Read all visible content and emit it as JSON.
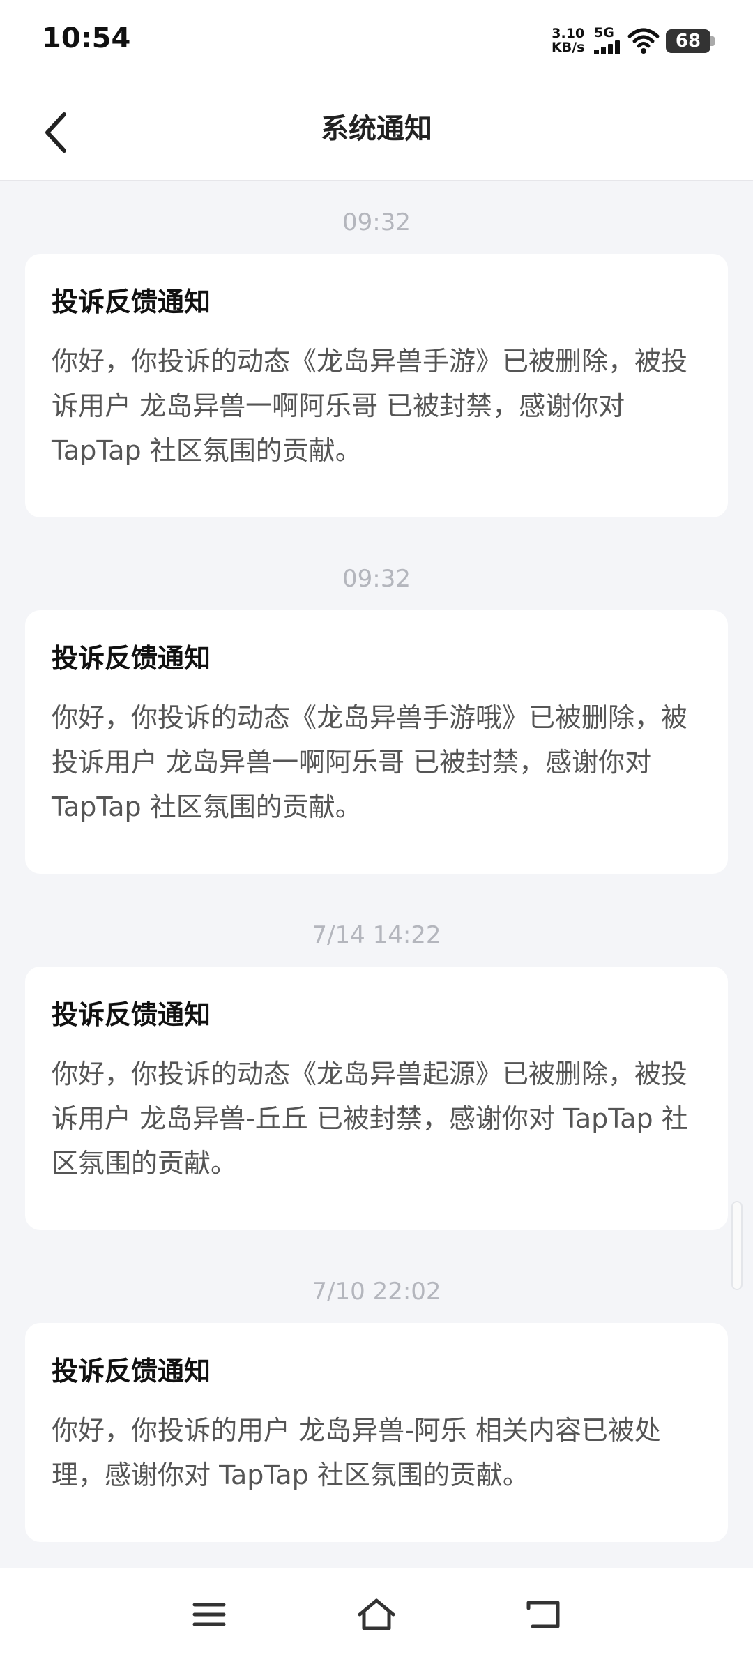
{
  "status_bar": {
    "time": "10:54",
    "net_speed_value": "3.10",
    "net_speed_unit": "KB/s",
    "network_type": "5G",
    "battery": "68"
  },
  "header": {
    "title": "系统通知"
  },
  "notifications": [
    {
      "time": "09:32",
      "title": "投诉反馈通知",
      "body": "你好，你投诉的动态《龙岛异兽手游》已被删除，被投诉用户 龙岛异兽一啊阿乐哥 已被封禁，感谢你对 TapTap 社区氛围的贡献。"
    },
    {
      "time": "09:32",
      "title": "投诉反馈通知",
      "body": "你好，你投诉的动态《龙岛异兽手游哦》已被删除，被投诉用户 龙岛异兽一啊阿乐哥 已被封禁，感谢你对 TapTap 社区氛围的贡献。"
    },
    {
      "time": "7/14  14:22",
      "title": "投诉反馈通知",
      "body": "你好，你投诉的动态《龙岛异兽起源》已被删除，被投诉用户 龙岛异兽-丘丘 已被封禁，感谢你对 TapTap 社区氛围的贡献。"
    },
    {
      "time": "7/10  22:02",
      "title": "投诉反馈通知",
      "body": "你好，你投诉的用户 龙岛异兽-阿乐 相关内容已被处理，感谢你对 TapTap 社区氛围的贡献。"
    }
  ],
  "icons": {
    "back": "chevron-left-icon",
    "menu": "menu-icon",
    "home": "home-icon",
    "back_nav": "back-nav-icon"
  }
}
